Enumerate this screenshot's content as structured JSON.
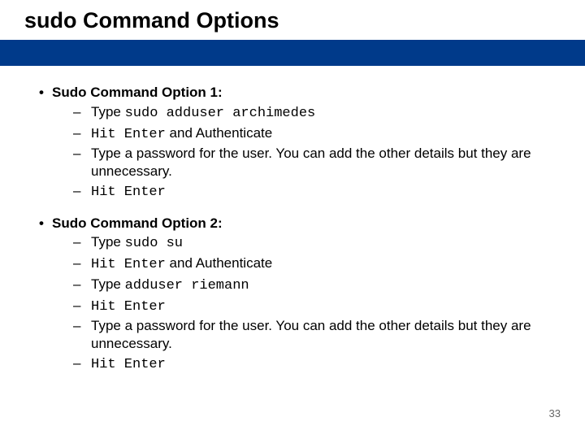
{
  "title": "sudo Command  Options",
  "page_number": "33",
  "option1": {
    "heading": "Sudo Command Option 1:",
    "step1_pre": "Type  ",
    "step1_cmd": "sudo adduser archimedes",
    "step2_pre_mono": "Hit Enter",
    "step2_post": " and Authenticate",
    "step3": "Type a password for the user.  You can add the other details but they are unnecessary.",
    "step4_mono": "Hit Enter"
  },
  "option2": {
    "heading": "Sudo Command Option 2:",
    "step1_pre": "Type  ",
    "step1_cmd": "sudo su",
    "step2_pre_mono": "Hit Enter",
    "step2_post": " and Authenticate",
    "step3_pre": "Type ",
    "step3_cmd": "adduser riemann",
    "step4_mono": "Hit Enter",
    "step5": "Type a password for the user.  You can add the other details but they are unnecessary.",
    "step6_mono": "Hit Enter"
  }
}
